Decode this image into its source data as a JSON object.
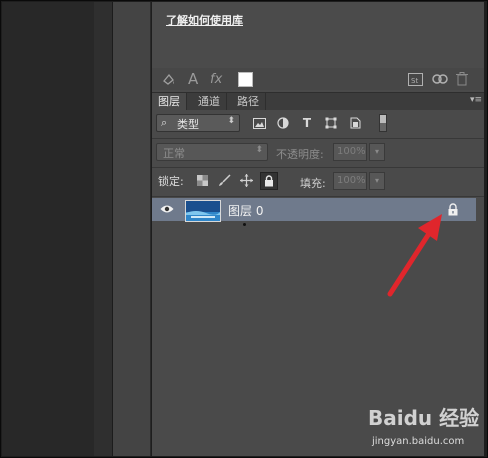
{
  "library": {
    "link_text": "了解如何使用库"
  },
  "tabs": [
    {
      "label": "图层"
    },
    {
      "label": "通道"
    },
    {
      "label": "路径"
    }
  ],
  "filter": {
    "selected": "类型",
    "icons": [
      "image-filter-icon",
      "adjustment-filter-icon",
      "type-filter-icon",
      "shape-filter-icon",
      "smart-object-filter-icon"
    ]
  },
  "blend": {
    "mode": "正常",
    "opacity_label": "不透明度:",
    "opacity_value": "100%"
  },
  "lock": {
    "label": "锁定:",
    "fill_label": "填充:",
    "fill_value": "100%"
  },
  "layer": {
    "name": "图层 0",
    "locked": true,
    "visible": true
  },
  "watermark": {
    "brand": "Baidu 经验",
    "url": "jingyan.baidu.com"
  },
  "colors": {
    "panel": "#4a4a4a",
    "selected_layer": "#6f7a8c",
    "annotation_arrow": "#e0262c"
  }
}
